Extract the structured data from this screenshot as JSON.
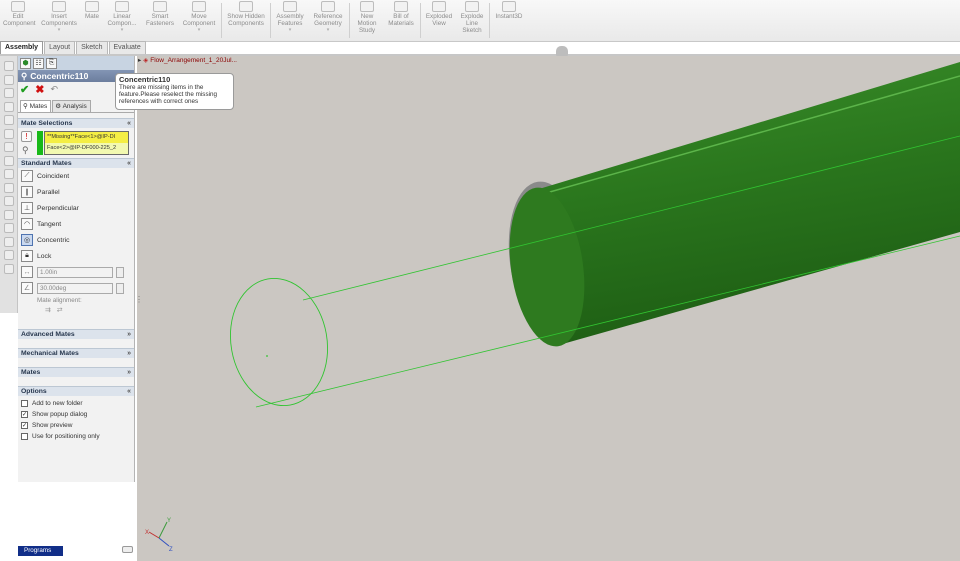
{
  "ribbon": {
    "buttons": [
      {
        "label": "Edit Component",
        "icon": "edit-component-icon"
      },
      {
        "label": "Insert Components",
        "icon": "insert-components-icon"
      },
      {
        "label": "Mate",
        "icon": "mate-icon"
      },
      {
        "label": "Linear Compon...",
        "icon": "linear-pattern-icon"
      },
      {
        "label": "Smart Fasteners",
        "icon": "smart-fasteners-icon"
      },
      {
        "label": "Move Component",
        "icon": "move-component-icon"
      },
      {
        "label": "Show Hidden Components",
        "icon": "show-hidden-icon"
      },
      {
        "label": "Assembly Features",
        "icon": "assembly-features-icon"
      },
      {
        "label": "Reference Geometry",
        "icon": "reference-geometry-icon"
      },
      {
        "label": "New Motion Study",
        "icon": "motion-study-icon"
      },
      {
        "label": "Bill of Materials",
        "icon": "bom-icon"
      },
      {
        "label": "Exploded View",
        "icon": "exploded-view-icon"
      },
      {
        "label": "Explode Line Sketch",
        "icon": "explode-line-icon"
      },
      {
        "label": "Instant3D",
        "icon": "instant3d-icon"
      }
    ]
  },
  "tabs": [
    "Assembly",
    "Layout",
    "Sketch",
    "Evaluate"
  ],
  "tree": {
    "item": "Flow_Arrangement_1_20Jul..."
  },
  "property_manager": {
    "title": "Concentric110",
    "tabs": {
      "mates": "Mates",
      "analysis": "Analysis"
    },
    "mate_selections": {
      "header": "Mate Selections",
      "item1": "**Missing**Face<1>@IP-DI",
      "item2": "Face<2>@IP-DF000-225_2"
    },
    "standard_mates": {
      "header": "Standard Mates",
      "items": [
        "Coincident",
        "Parallel",
        "Perpendicular",
        "Tangent",
        "Concentric",
        "Lock"
      ],
      "distance": "1.00in",
      "angle": "30.00deg",
      "alignment_label": "Mate alignment:"
    },
    "advanced_header": "Advanced Mates",
    "mechanical_header": "Mechanical Mates",
    "mates_header": "Mates",
    "options": {
      "header": "Options",
      "items": [
        {
          "label": "Add to new folder",
          "checked": false
        },
        {
          "label": "Show popup dialog",
          "checked": true
        },
        {
          "label": "Show preview",
          "checked": true
        },
        {
          "label": "Use for positioning only",
          "checked": false
        }
      ]
    }
  },
  "tooltip": {
    "title": "Concentric110",
    "body": "There are missing items in the feature.Please reselect the missing references with correct ones"
  },
  "taskbar": {
    "programs": "Programs"
  },
  "triad": {
    "x": "X",
    "y": "Y",
    "z": "Z"
  },
  "colors": {
    "pipe": "#2e7a1f",
    "preview": "#31c431",
    "background": "#cbc7c2"
  }
}
